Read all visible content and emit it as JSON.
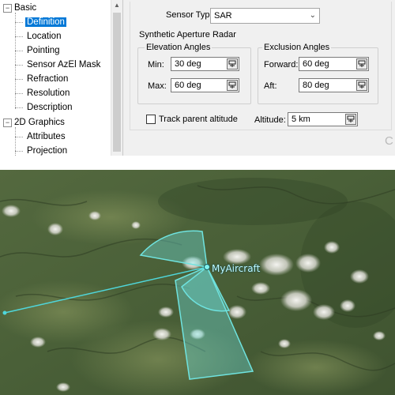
{
  "tree": {
    "items": [
      {
        "label": "Basic",
        "type": "group"
      },
      {
        "label": "Definition",
        "selected": true
      },
      {
        "label": "Location"
      },
      {
        "label": "Pointing"
      },
      {
        "label": "Sensor AzEl Mask"
      },
      {
        "label": "Refraction"
      },
      {
        "label": "Resolution"
      },
      {
        "label": "Description"
      },
      {
        "label": "2D Graphics",
        "type": "group"
      },
      {
        "label": "Attributes"
      },
      {
        "label": "Projection"
      }
    ]
  },
  "definition": {
    "sensor_type_label": "Sensor Type:",
    "sensor_type_value": "SAR",
    "sar_group_title": "Synthetic Aperture Radar",
    "elevation": {
      "title": "Elevation Angles",
      "min_label": "Min:",
      "min_value": "30 deg",
      "max_label": "Max:",
      "max_value": "60 deg"
    },
    "exclusion": {
      "title": "Exclusion Angles",
      "forward_label": "Forward:",
      "forward_value": "60 deg",
      "aft_label": "Aft:",
      "aft_value": "80 deg"
    },
    "track_parent_altitude_label": "Track parent altitude",
    "track_parent_altitude_checked": false,
    "altitude_label": "Altitude:",
    "altitude_value": "5 km",
    "watermark_text": "C"
  },
  "map": {
    "aircraft_label": "MyAircraft",
    "sensor_color": "#6fe3df",
    "track_color": "#4fd6da"
  }
}
